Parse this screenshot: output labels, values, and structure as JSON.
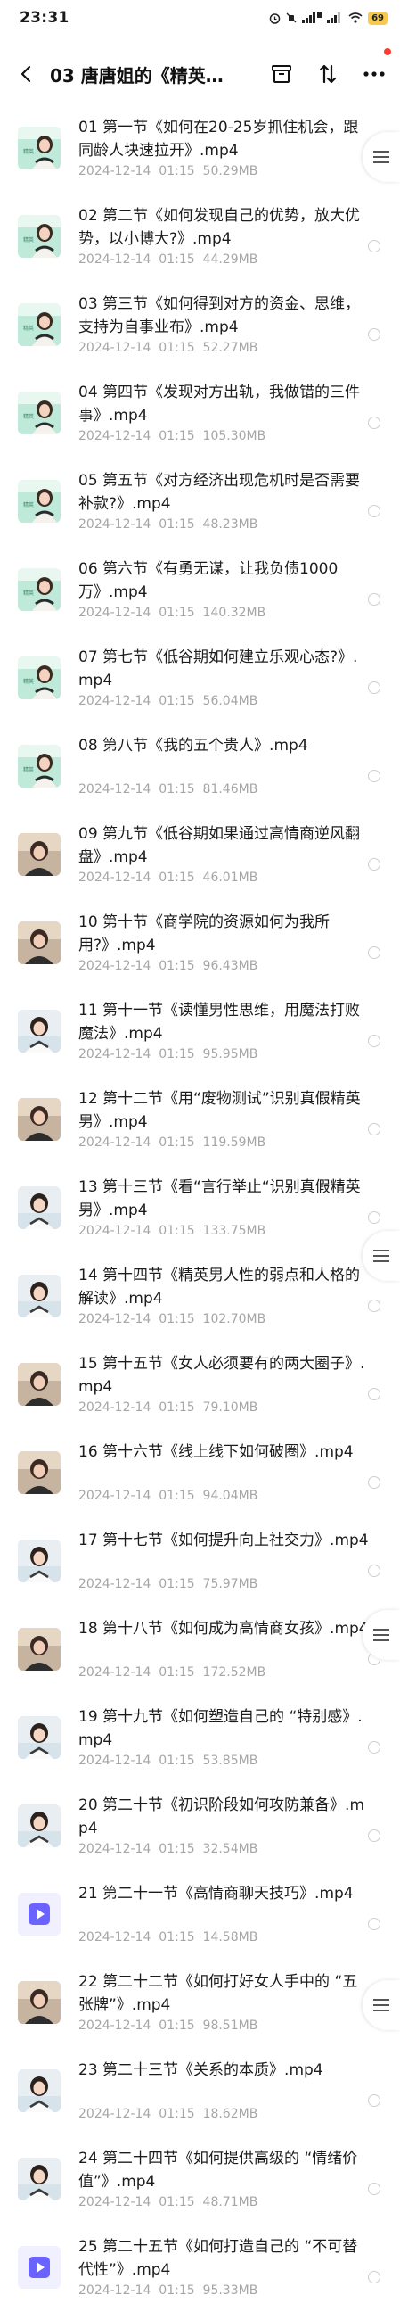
{
  "status": {
    "time": "23:31",
    "battery": "69"
  },
  "header": {
    "title": "03 唐唐姐的《精英…"
  },
  "colors": {
    "meta_gray": "#a6a6a6",
    "play_icon": "#6b63ff",
    "battery": "#f7c94c"
  },
  "files": [
    {
      "name": "01 第一节《如何在20-25岁抓住机会，跟同龄人块速拉开》.mp4",
      "date": "2024-12-14",
      "time": "01:15",
      "size": "50.29MB",
      "thumb": "green-woman"
    },
    {
      "name": "02 第二节《如何发现自己的优势，放大优势，以小博大?》.mp4",
      "date": "2024-12-14",
      "time": "01:15",
      "size": "44.29MB",
      "thumb": "green-woman"
    },
    {
      "name": "03 第三节《如何得到对方的资金、思维，支持为自事业布》.mp4",
      "date": "2024-12-14",
      "time": "01:15",
      "size": "52.27MB",
      "thumb": "green-woman"
    },
    {
      "name": "04 第四节《发现对方出轨，我做错的三件事》.mp4",
      "date": "2024-12-14",
      "time": "01:15",
      "size": "105.30MB",
      "thumb": "green-woman"
    },
    {
      "name": "05 第五节《对方经济出现危机时是否需要补款?》.mp4",
      "date": "2024-12-14",
      "time": "01:15",
      "size": "48.23MB",
      "thumb": "green-woman"
    },
    {
      "name": "06 第六节《有勇无谋，让我负债1000万》.mp4",
      "date": "2024-12-14",
      "time": "01:15",
      "size": "140.32MB",
      "thumb": "green-woman"
    },
    {
      "name": "07 第七节《低谷期如何建立乐观心态?》.mp4",
      "date": "2024-12-14",
      "time": "01:15",
      "size": "56.04MB",
      "thumb": "green-woman"
    },
    {
      "name": "08 第八节《我的五个贵人》.mp4",
      "date": "2024-12-14",
      "time": "01:15",
      "size": "81.46MB",
      "thumb": "green-woman"
    },
    {
      "name": "09 第九节《低谷期如果通过高情商逆风翻盘》.mp4",
      "date": "2024-12-14",
      "time": "01:15",
      "size": "46.01MB",
      "thumb": "office-woman"
    },
    {
      "name": "10 第十节《商学院的资源如何为我所用?》.mp4",
      "date": "2024-12-14",
      "time": "01:15",
      "size": "96.43MB",
      "thumb": "office-woman"
    },
    {
      "name": "11 第十一节《读懂男性思维，用魔法打败魔法》.mp4",
      "date": "2024-12-14",
      "time": "01:15",
      "size": "95.95MB",
      "thumb": "bright-woman"
    },
    {
      "name": "12 第十二节《用“废物测试”识别真假精英男》.mp4",
      "date": "2024-12-14",
      "time": "01:15",
      "size": "119.59MB",
      "thumb": "office-woman"
    },
    {
      "name": "13 第十三节《看“言行举止“识别真假精英男》.mp4",
      "date": "2024-12-14",
      "time": "01:15",
      "size": "133.75MB",
      "thumb": "bright-woman"
    },
    {
      "name": "14 第十四节《精英男人性的弱点和人格的解读》.mp4",
      "date": "2024-12-14",
      "time": "01:15",
      "size": "102.70MB",
      "thumb": "bright-woman"
    },
    {
      "name": "15 第十五节《女人必须要有的两大圈子》.mp4",
      "date": "2024-12-14",
      "time": "01:15",
      "size": "79.10MB",
      "thumb": "office-woman"
    },
    {
      "name": "16 第十六节《线上线下如何破圈》.mp4",
      "date": "2024-12-14",
      "time": "01:15",
      "size": "94.04MB",
      "thumb": "office-woman"
    },
    {
      "name": "17 第十七节《如何提升向上社交力》.mp4",
      "date": "2024-12-14",
      "time": "01:15",
      "size": "75.97MB",
      "thumb": "bright-woman"
    },
    {
      "name": "18 第十八节《如何成为高情商女孩》.mp4",
      "date": "2024-12-14",
      "time": "01:15",
      "size": "172.52MB",
      "thumb": "office-woman"
    },
    {
      "name": "19 第十九节《如何塑造自己的 “特别感》.mp4",
      "date": "2024-12-14",
      "time": "01:15",
      "size": "53.85MB",
      "thumb": "bright-woman"
    },
    {
      "name": "20 第二十节《初识阶段如何攻防兼备》.mp4",
      "date": "2024-12-14",
      "time": "01:15",
      "size": "32.54MB",
      "thumb": "bright-woman"
    },
    {
      "name": "21 第二十一节《高情商聊天技巧》.mp4",
      "date": "2024-12-14",
      "time": "01:15",
      "size": "14.58MB",
      "thumb": "play-icon"
    },
    {
      "name": "22 第二十二节《如何打好女人手中的 “五张牌”》.mp4",
      "date": "2024-12-14",
      "time": "01:15",
      "size": "98.51MB",
      "thumb": "office-woman"
    },
    {
      "name": "23 第二十三节《关系的本质》.mp4",
      "date": "2024-12-14",
      "time": "01:15",
      "size": "18.62MB",
      "thumb": "bright-woman"
    },
    {
      "name": "24 第二十四节《如何提供高级的 “情绪价值”》.mp4",
      "date": "2024-12-14",
      "time": "01:15",
      "size": "48.71MB",
      "thumb": "bright-woman"
    },
    {
      "name": "25 第二十五节《如何打造自己的 “不可替代性”》.mp4",
      "date": "2024-12-14",
      "time": "01:15",
      "size": "95.33MB",
      "thumb": "play-icon"
    }
  ]
}
